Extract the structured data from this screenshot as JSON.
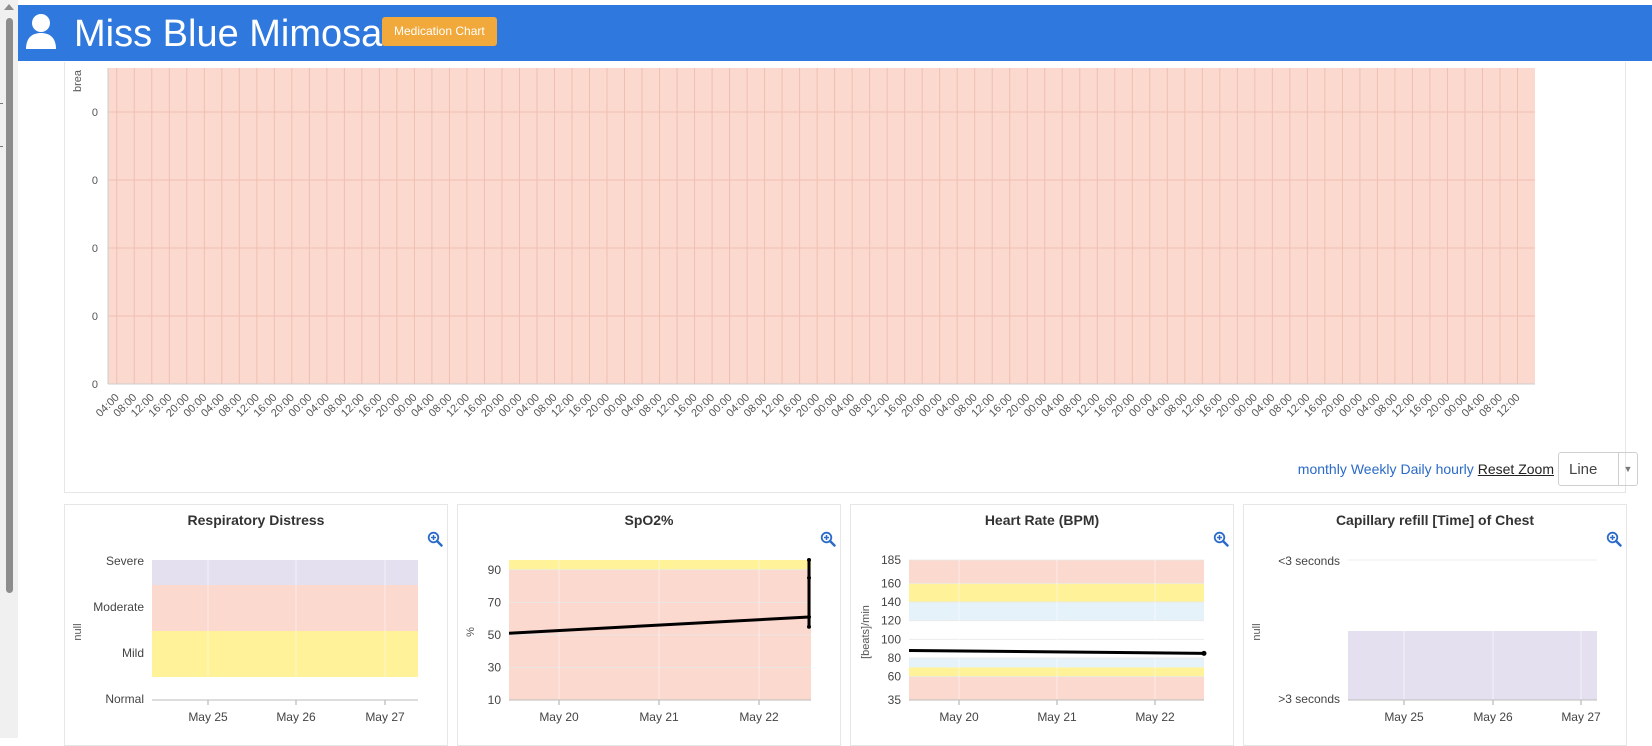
{
  "header": {
    "patient_name": "Miss Blue Mimosa",
    "medication_button": "Medication Chart",
    "avatar_icon": "user-icon",
    "bg_color": "#2f78de"
  },
  "main_chart": {
    "ylabel": "brea",
    "y_tick_labels": [
      "0",
      "0",
      "0",
      "0",
      "0"
    ],
    "time_labels": [
      "04:00",
      "08:00",
      "12:00",
      "16:00",
      "20:00",
      "00:00",
      "04:00",
      "08:00",
      "12:00",
      "16:00",
      "20:00",
      "00:00",
      "04:00",
      "08:00",
      "12:00",
      "16:00",
      "20:00",
      "00:00",
      "04:00",
      "08:00",
      "12:00",
      "16:00",
      "20:00",
      "00:00",
      "04:00",
      "08:00",
      "12:00",
      "16:00",
      "20:00",
      "00:00",
      "04:00",
      "08:00",
      "12:00",
      "16:00",
      "20:00",
      "00:00",
      "04:00",
      "08:00",
      "12:00",
      "16:00",
      "20:00",
      "00:00",
      "04:00",
      "08:00",
      "12:00",
      "16:00",
      "20:00",
      "00:00",
      "04:00",
      "08:00",
      "12:00",
      "16:00",
      "20:00",
      "00:00",
      "04:00",
      "08:00",
      "12:00",
      "16:00",
      "20:00",
      "00:00",
      "04:00",
      "08:00",
      "12:00",
      "16:00",
      "20:00",
      "00:00",
      "04:00",
      "08:00",
      "12:00",
      "16:00",
      "20:00",
      "00:00",
      "04:00",
      "08:00",
      "12:00",
      "16:00",
      "20:00",
      "00:00",
      "04:00",
      "08:00",
      "12:00"
    ],
    "band_color": "#fcd9ce"
  },
  "controls": {
    "monthly": "monthly",
    "weekly": "Weekly",
    "daily": "Daily",
    "hourly": "hourly",
    "reset_zoom": "Reset Zoom",
    "chart_type": "Line",
    "caret": "▼"
  },
  "chart_data": [
    {
      "type": "line",
      "title": "Respiratory Distress",
      "ylabel": "null",
      "y_categories": [
        "Normal",
        "Mild",
        "Moderate",
        "Severe"
      ],
      "x_ticks": [
        "May 25",
        "May 26",
        "May 27"
      ],
      "bands": [
        {
          "from": "Normal",
          "to": "Mild",
          "color": "#fff298"
        },
        {
          "from": "Mild",
          "to": "Moderate",
          "color": "#fff298"
        },
        {
          "from": "Moderate",
          "to": "Severe",
          "color": "#fcd9ce"
        },
        {
          "from": "Severe",
          "to": "top",
          "color": "#e5e0f0"
        }
      ],
      "series": []
    },
    {
      "type": "line",
      "title": "SpO2%",
      "ylabel": "%",
      "ylim": [
        10,
        96
      ],
      "y_ticks": [
        10,
        30,
        50,
        70,
        90
      ],
      "x_ticks": [
        "May 20",
        "May 21",
        "May 22"
      ],
      "bands": [
        {
          "from": 10,
          "to": 90,
          "color": "#fcd9ce"
        },
        {
          "from": 90,
          "to": 96,
          "color": "#fff298"
        }
      ],
      "series": [
        {
          "x": [
            "May 19.5",
            "May 22.5"
          ],
          "values": [
            51,
            61
          ]
        },
        {
          "x": [
            "May 22.5",
            "May 22.5"
          ],
          "values": [
            55,
            96
          ]
        }
      ],
      "points": [
        {
          "x": "May 22.5",
          "values": [
            55,
            61,
            85,
            96
          ]
        }
      ]
    },
    {
      "type": "line",
      "title": "Heart Rate (BPM)",
      "ylabel": "[beats]/min",
      "ylim": [
        35,
        185
      ],
      "y_ticks": [
        35,
        60,
        80,
        100,
        120,
        140,
        160,
        185
      ],
      "x_ticks": [
        "May 20",
        "May 21",
        "May 22"
      ],
      "bands": [
        {
          "from": 35,
          "to": 60,
          "color": "#fcd9ce"
        },
        {
          "from": 60,
          "to": 70,
          "color": "#fff298"
        },
        {
          "from": 70,
          "to": 80,
          "color": "#e6f2fa"
        },
        {
          "from": 80,
          "to": 120,
          "color": "#ffffff"
        },
        {
          "from": 120,
          "to": 140,
          "color": "#e6f2fa"
        },
        {
          "from": 140,
          "to": 160,
          "color": "#fff298"
        },
        {
          "from": 160,
          "to": 185,
          "color": "#fcd9ce"
        }
      ],
      "series": [
        {
          "x": [
            "May 19.5",
            "May 22.5"
          ],
          "values": [
            88,
            85
          ]
        }
      ]
    },
    {
      "type": "line",
      "title": "Capillary refill [Time] of Chest",
      "ylabel": "null",
      "y_categories": [
        ">3 seconds",
        "<3 seconds"
      ],
      "x_ticks": [
        "May 25",
        "May 26",
        "May 27"
      ],
      "bands": [
        {
          "from": ">3 seconds",
          "to": "mid",
          "color": "#e5e0f0"
        }
      ],
      "series": []
    }
  ],
  "icons": {
    "zoom": "zoom-in-icon"
  }
}
